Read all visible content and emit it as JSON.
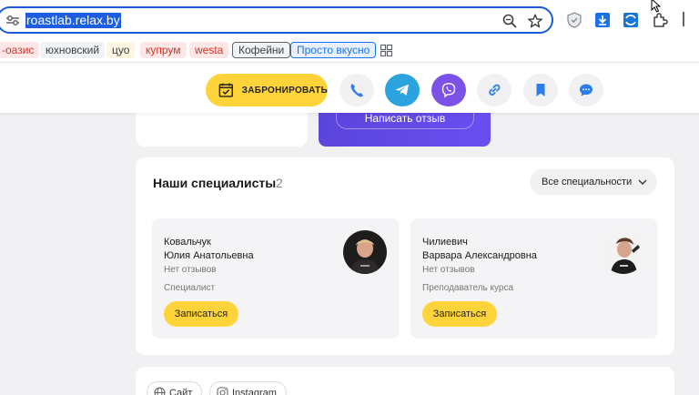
{
  "browser": {
    "url": "roastlab.relax.by",
    "bookmarks": [
      {
        "label": "-оазис",
        "color": "#d93025",
        "bg": "#fde8e7"
      },
      {
        "label": "юхновский",
        "color": "#3c4043",
        "bg": "#f1f3f4"
      },
      {
        "label": "цуо",
        "color": "#3c4043",
        "bg": "#fef6e0"
      },
      {
        "label": "купрум",
        "color": "#d93025",
        "bg": "#fde8e7"
      },
      {
        "label": "westa",
        "color": "#d93025",
        "bg": "#fde8e7"
      },
      {
        "label": "Кофейни",
        "color": "#3c4043",
        "bg": "#f1f3f4"
      },
      {
        "label": "Просто вкусно",
        "color": "#1a73e8",
        "bg": "#e8f0fe"
      }
    ]
  },
  "actions": {
    "book_label": "ЗАБРОНИРОВАТЬ"
  },
  "review": {
    "button_label": "Написать отзыв"
  },
  "specialists": {
    "title": "Наши специалисты",
    "count": "2",
    "filter_label": "Все специальности",
    "cards": [
      {
        "surname": "Ковальчук",
        "name": "Юлия Анатольевна",
        "reviews": "Нет отзывов",
        "role": "Специалист",
        "book_label": "Записаться"
      },
      {
        "surname": "Чилиевич",
        "name": "Варвара Александровна",
        "reviews": "Нет отзывов",
        "role": "Преподаватель курса",
        "book_label": "Записаться"
      }
    ]
  },
  "links": [
    {
      "label": "Сайт",
      "icon": "globe-icon"
    },
    {
      "label": "Instagram",
      "icon": "instagram-icon"
    }
  ],
  "colors": {
    "accent": "#ffd43b",
    "telegram": "#2aa3df",
    "viber": "#7b51e8",
    "brand_blue": "#2b7de9",
    "review_purple": "#5b45dc"
  }
}
